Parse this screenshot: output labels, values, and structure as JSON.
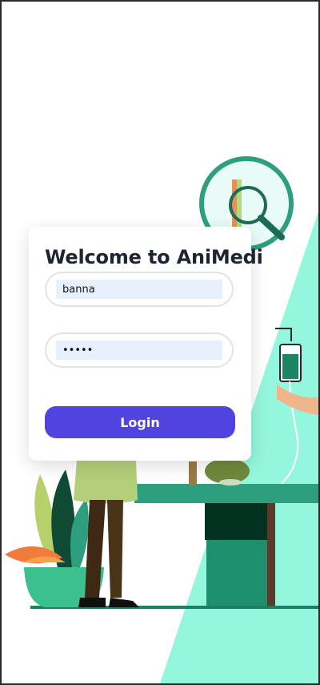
{
  "login": {
    "title": "Welcome to AniMedi",
    "username_value": "banna",
    "password_value": "banna",
    "login_label": "Login"
  },
  "colors": {
    "accent": "#5143e0",
    "mint": "#8ef5dc",
    "teal_dark": "#1b7f63"
  },
  "illustration": {
    "icons": [
      "magnifier-icon",
      "iv-drip-icon",
      "plant-icon",
      "vet-table-icon"
    ]
  }
}
